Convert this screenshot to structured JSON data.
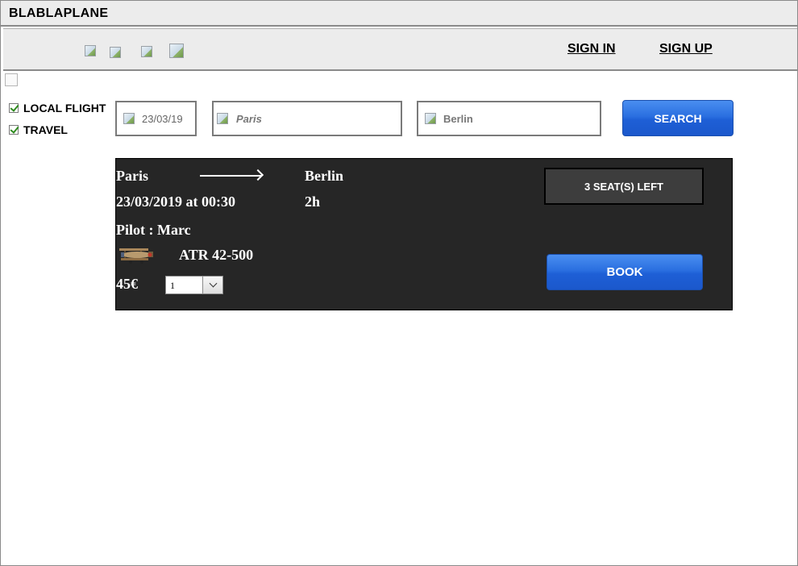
{
  "app": {
    "title": "BLABLAPLANE"
  },
  "nav": {
    "icons": [
      "image-placeholder-icon",
      "image-placeholder-icon",
      "image-placeholder-icon",
      "image-placeholder-icon"
    ],
    "sign_in": "SIGN IN",
    "sign_up": "SIGN UP"
  },
  "filters": {
    "local_flight": {
      "label": "LOCAL FLIGHT",
      "checked": true
    },
    "travel": {
      "label": "TRAVEL",
      "checked": true
    }
  },
  "search": {
    "date": "23/03/19",
    "from": "Paris",
    "to": "Berlin",
    "button": "SEARCH"
  },
  "flight": {
    "from": "Paris",
    "to": "Berlin",
    "datetime": "23/03/2019 at 00:30",
    "duration": "2h",
    "pilot": "Pilot : Marc",
    "aircraft": "ATR 42-500",
    "price": "45€",
    "seats_left": "3 SEAT(S) LEFT",
    "seat_count_selected": "1",
    "book": "BOOK"
  },
  "colors": {
    "accent_blue": "#2a6fe0",
    "card_bg": "#262626",
    "chrome_gray": "#ececec"
  }
}
